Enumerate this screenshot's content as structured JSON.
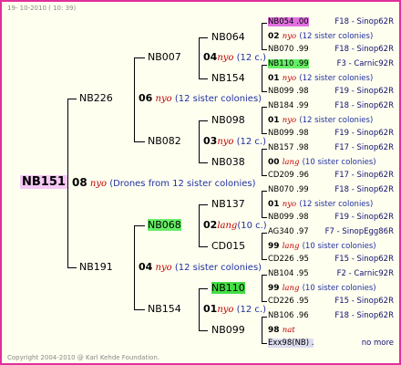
{
  "header": {
    "date": "19- 10-2010 ( 10: 39)"
  },
  "footer": {
    "copyright": "Copyright 2004-2010 @ Karl Kehde Foundation."
  },
  "root": {
    "id": "NB151",
    "gen": "08",
    "mating": "nyo",
    "remark": "(Drones from 12 sister colonies)"
  },
  "gen1": [
    {
      "id": "NB226",
      "gen": "06",
      "mating": "nyo",
      "remark": "(12 sister colonies)"
    },
    {
      "id": "NB191",
      "gen": "04",
      "mating": "nyo",
      "remark": "(12 sister colonies)"
    }
  ],
  "gen2": [
    {
      "id": "NB007",
      "gen": "04",
      "mating": "nyo",
      "remark": "(12 c.)"
    },
    {
      "id": "NB082",
      "gen": "03",
      "mating": "nyo",
      "remark": "(12 c.)"
    },
    {
      "id": "NB068",
      "gen": "02",
      "mating": "lang",
      "remark": "(10 c.)"
    },
    {
      "id": "NB154",
      "gen": "01",
      "mating": "nyo",
      "remark": "(12 c.)"
    }
  ],
  "gen3": [
    "NB064",
    "NB154",
    "NB098",
    "NB038",
    "NB137",
    "CD015",
    "NB110",
    "NB099"
  ],
  "gen4": [
    {
      "id": "NB054 .00",
      "line": "F18 - Sinop62R"
    },
    {
      "gen": "02",
      "mating": "nyo",
      "remark": "(12 sister colonies)"
    },
    {
      "id": "NB070 .99",
      "line": "F18 - Sinop62R"
    },
    {
      "id": "NB110 .99",
      "line": "F3 - Carnic92R"
    },
    {
      "gen": "01",
      "mating": "nyo",
      "remark": "(12 sister colonies)"
    },
    {
      "id": "NB099 .98",
      "line": "F19 - Sinop62R"
    },
    {
      "id": "NB184 .99",
      "line": "F18 - Sinop62R"
    },
    {
      "gen": "01",
      "mating": "nyo",
      "remark": "(12 sister colonies)"
    },
    {
      "id": "NB099 .98",
      "line": "F19 - Sinop62R"
    },
    {
      "id": "NB157 .98",
      "line": "F17 - Sinop62R"
    },
    {
      "gen": "00",
      "mating": "lang",
      "remark": "(10 sister colonies)"
    },
    {
      "id": "CD209 .96",
      "line": "F17 - Sinop62R"
    },
    {
      "id": "NB070 .99",
      "line": "F18 - Sinop62R"
    },
    {
      "gen": "01",
      "mating": "nyo",
      "remark": "(12 sister colonies)"
    },
    {
      "id": "NB099 .98",
      "line": "F19 - Sinop62R"
    },
    {
      "id": "AG340 .97",
      "line": "F7 - SinopEgg86R"
    },
    {
      "gen": "99",
      "mating": "lang",
      "remark": "(10 sister colonies)"
    },
    {
      "id": "CD226 .95",
      "line": "F15 - Sinop62R"
    },
    {
      "id": "NB104 .95",
      "line": "F2 - Carnic92R"
    },
    {
      "gen": "99",
      "mating": "lang",
      "remark": "(10 sister colonies)"
    },
    {
      "id": "CD226 .95",
      "line": "F15 - Sinop62R"
    },
    {
      "id": "NB106 .96",
      "line": "F18 - Sinop62R"
    },
    {
      "gen": "98",
      "mating": "nat",
      "remark": ""
    },
    {
      "id": "Exx98(NB) .",
      "line": "no more"
    }
  ]
}
